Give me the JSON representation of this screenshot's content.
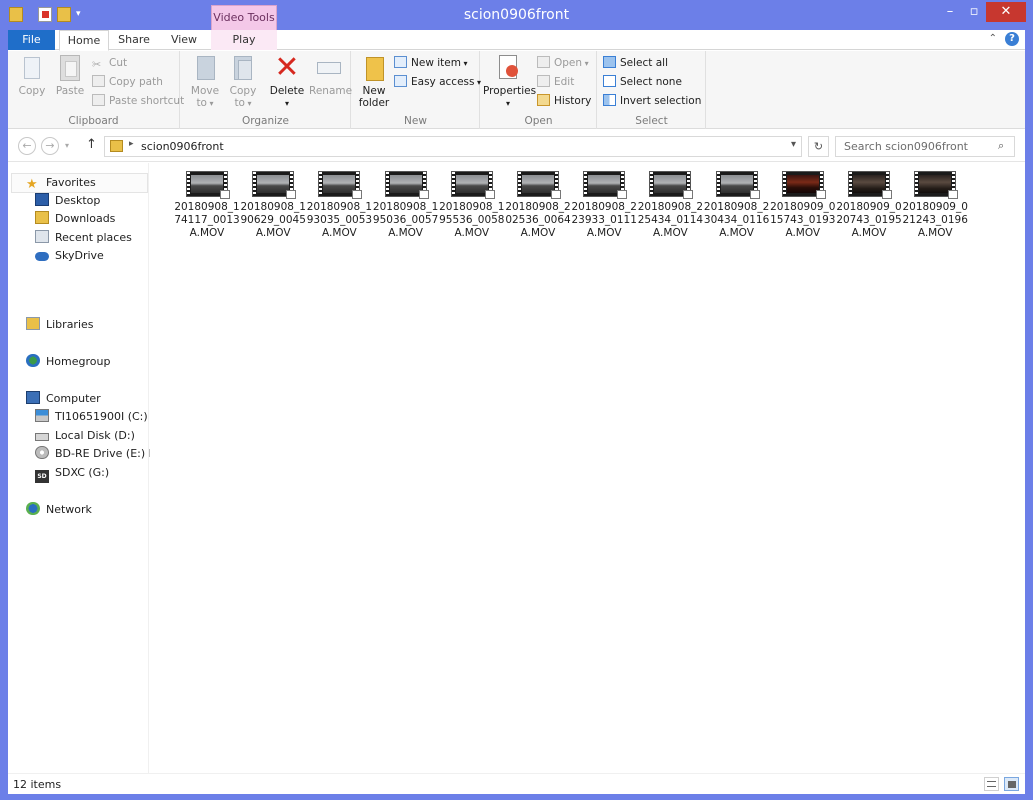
{
  "window": {
    "title": "scion0906front",
    "context_tab": "Video Tools"
  },
  "ribbon_tabs": [
    "File",
    "Home",
    "Share",
    "View",
    "Play"
  ],
  "clipboard": {
    "copy": "Copy",
    "paste": "Paste",
    "cut": "Cut",
    "copy_path": "Copy path",
    "paste_shortcut": "Paste shortcut",
    "label": "Clipboard"
  },
  "organize": {
    "move_to": [
      "Move",
      "to"
    ],
    "copy_to": [
      "Copy",
      "to"
    ],
    "delete": "Delete",
    "rename": "Rename",
    "label": "Organize"
  },
  "new": {
    "new_folder": [
      "New",
      "folder"
    ],
    "new_item": "New item",
    "easy_access": "Easy access",
    "label": "New"
  },
  "open": {
    "properties": "Properties",
    "open": "Open",
    "edit": "Edit",
    "history": "History",
    "label": "Open"
  },
  "select": {
    "select_all": "Select all",
    "select_none": "Select none",
    "invert": "Invert selection",
    "label": "Select"
  },
  "address": {
    "path": "scion0906front",
    "search_placeholder": "Search scion0906front"
  },
  "nav": {
    "favorites": "Favorites",
    "fav_items": [
      "Desktop",
      "Downloads",
      "Recent places",
      "SkyDrive"
    ],
    "libraries": "Libraries",
    "homegroup": "Homegroup",
    "computer": "Computer",
    "drives": [
      "TI10651900I (C:)",
      "Local Disk (D:)",
      "BD-RE Drive (E:) HEL",
      "SDXC (G:)"
    ],
    "network": "Network"
  },
  "files": [
    {
      "name": [
        "20180908_1",
        "74117_0013",
        "A.MOV"
      ],
      "scene": "day"
    },
    {
      "name": [
        "20180908_1",
        "90629_0045",
        "A.MOV"
      ],
      "scene": "day"
    },
    {
      "name": [
        "20180908_1",
        "93035_0053",
        "A.MOV"
      ],
      "scene": "day"
    },
    {
      "name": [
        "20180908_1",
        "95036_0057",
        "A.MOV"
      ],
      "scene": "day"
    },
    {
      "name": [
        "20180908_1",
        "95536_0058",
        "A.MOV"
      ],
      "scene": "day"
    },
    {
      "name": [
        "20180908_2",
        "02536_0064",
        "A.MOV"
      ],
      "scene": "day"
    },
    {
      "name": [
        "20180908_2",
        "23933_0111",
        "A.MOV"
      ],
      "scene": "day"
    },
    {
      "name": [
        "20180908_2",
        "25434_0114",
        "A.MOV"
      ],
      "scene": "day"
    },
    {
      "name": [
        "20180908_2",
        "30434_0116",
        "A.MOV"
      ],
      "scene": "day"
    },
    {
      "name": [
        "20180909_0",
        "15743_0193",
        "A.MOV"
      ],
      "scene": "night"
    },
    {
      "name": [
        "20180909_0",
        "20743_0195",
        "A.MOV"
      ],
      "scene": "dusk"
    },
    {
      "name": [
        "20180909_0",
        "21243_0196",
        "A.MOV"
      ],
      "scene": "dusk"
    }
  ],
  "status": {
    "items": "12 items"
  },
  "colors": {
    "frame": "#6c7fe8",
    "file_tab": "#1f6ec9",
    "context_tab": "#f4c8e8",
    "close": "#c7372f"
  }
}
